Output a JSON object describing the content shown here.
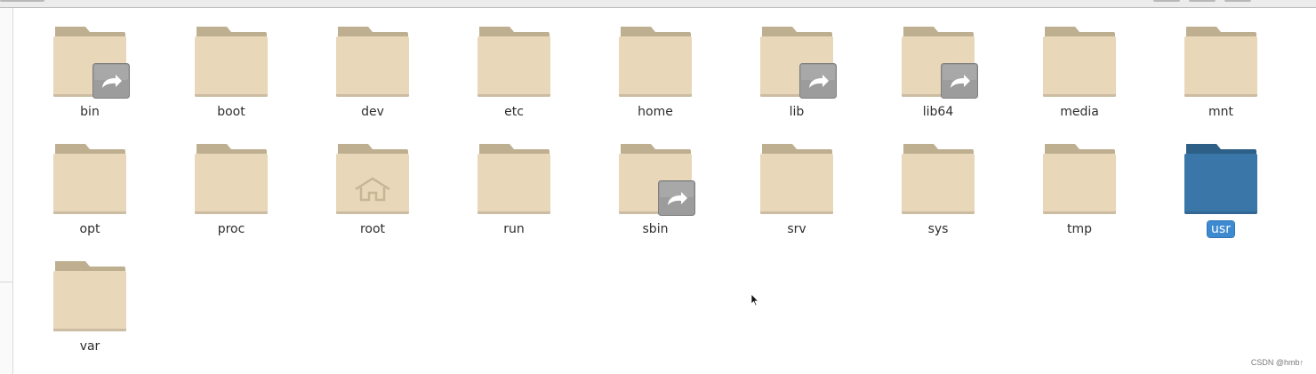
{
  "folders": [
    {
      "name": "bin",
      "emblem": "symlink-arrow-icon",
      "selected": false
    },
    {
      "name": "boot",
      "emblem": "",
      "selected": false
    },
    {
      "name": "dev",
      "emblem": "",
      "selected": false
    },
    {
      "name": "etc",
      "emblem": "",
      "selected": false
    },
    {
      "name": "home",
      "emblem": "",
      "selected": false
    },
    {
      "name": "lib",
      "emblem": "symlink-arrow-icon",
      "selected": false
    },
    {
      "name": "lib64",
      "emblem": "symlink-arrow-icon",
      "selected": false
    },
    {
      "name": "media",
      "emblem": "",
      "selected": false
    },
    {
      "name": "mnt",
      "emblem": "",
      "selected": false
    },
    {
      "name": "opt",
      "emblem": "",
      "selected": false
    },
    {
      "name": "proc",
      "emblem": "",
      "selected": false
    },
    {
      "name": "root",
      "emblem": "home-outline-icon",
      "selected": false
    },
    {
      "name": "run",
      "emblem": "",
      "selected": false
    },
    {
      "name": "sbin",
      "emblem": "symlink-arrow-icon",
      "selected": false
    },
    {
      "name": "srv",
      "emblem": "",
      "selected": false
    },
    {
      "name": "sys",
      "emblem": "",
      "selected": false
    },
    {
      "name": "tmp",
      "emblem": "",
      "selected": false
    },
    {
      "name": "usr",
      "emblem": "",
      "selected": true
    },
    {
      "name": "var",
      "emblem": "",
      "selected": false
    }
  ],
  "colors": {
    "folder_body": "#e8d7b9",
    "folder_back": "#bfaf91",
    "folder_selected_body": "#3a77a8",
    "folder_selected_back": "#2e5f86",
    "selection_label_bg": "#3d8ad1",
    "emblem_bg": "#9c9c9c"
  },
  "watermark": "CSDN @hmb↑"
}
